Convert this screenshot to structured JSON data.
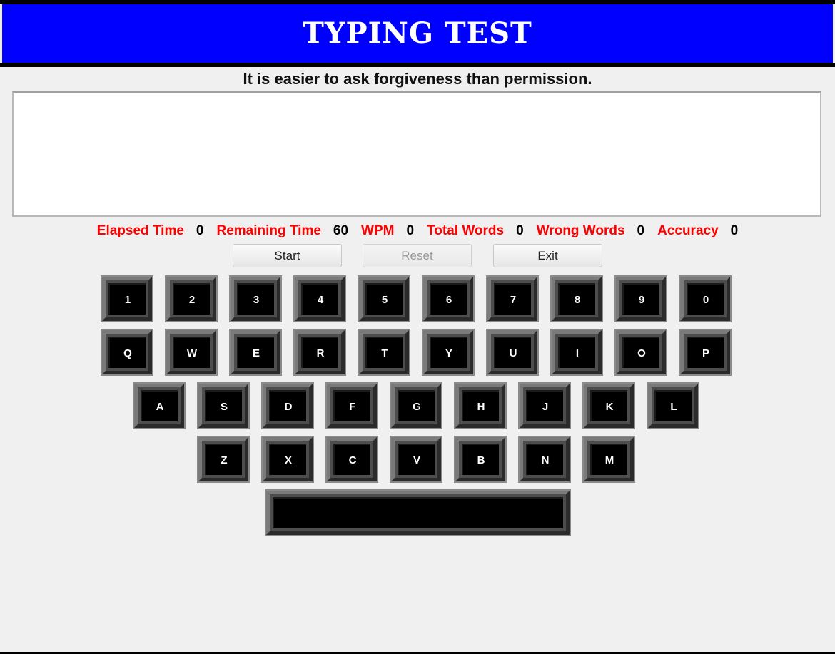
{
  "header": {
    "title": "TYPING TEST"
  },
  "quote": {
    "text": "It is easier to ask forgiveness than permission."
  },
  "typing_area": {
    "value": ""
  },
  "stats": [
    {
      "label": "Elapsed Time",
      "value": "0"
    },
    {
      "label": "Remaining Time",
      "value": "60"
    },
    {
      "label": "WPM",
      "value": "0"
    },
    {
      "label": "Total Words",
      "value": "0"
    },
    {
      "label": "Wrong Words",
      "value": "0"
    },
    {
      "label": "Accuracy",
      "value": "0"
    }
  ],
  "buttons": {
    "start_label": "Start",
    "reset_label": "Reset",
    "exit_label": "Exit",
    "reset_disabled": true
  },
  "keyboard": {
    "rows": [
      [
        "1",
        "2",
        "3",
        "4",
        "5",
        "6",
        "7",
        "8",
        "9",
        "0"
      ],
      [
        "Q",
        "W",
        "E",
        "R",
        "T",
        "Y",
        "U",
        "I",
        "O",
        "P"
      ],
      [
        "A",
        "S",
        "D",
        "F",
        "G",
        "H",
        "J",
        "K",
        "L"
      ],
      [
        "Z",
        "X",
        "C",
        "V",
        "B",
        "N",
        "M"
      ]
    ],
    "space_label": ""
  },
  "colors": {
    "header_bg": "#0000ff",
    "stat_label": "#ff0000",
    "key_face": "#000000"
  }
}
